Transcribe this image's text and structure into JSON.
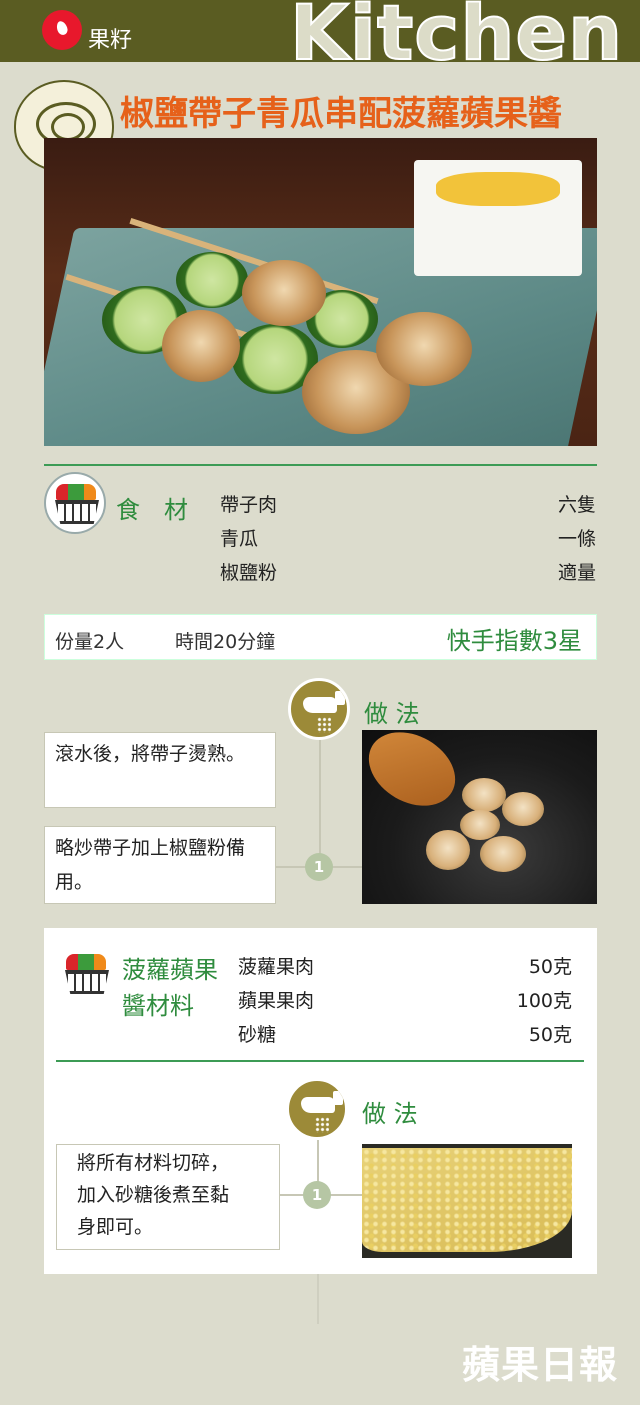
{
  "header": {
    "brand": "果籽",
    "section": "Kitchen"
  },
  "recipe": {
    "title": "椒鹽帶子青瓜串配菠蘿蘋果醬"
  },
  "ingredients": {
    "label": "食　材",
    "items": [
      {
        "name": "帶子肉",
        "amount": "六隻"
      },
      {
        "name": "青瓜",
        "amount": "一條"
      },
      {
        "name": "椒鹽粉",
        "amount": "適量"
      }
    ]
  },
  "info": {
    "servings": "份量2人",
    "time": "時間20分鐘",
    "quick_index": "快手指數3星"
  },
  "method1": {
    "label": "做 法",
    "steps": [
      "滾水後，將帶子燙熟。",
      "略炒帶子加上椒鹽粉備用。"
    ],
    "step_number": "1"
  },
  "sauce": {
    "label_line1": "菠蘿蘋果",
    "label_line2": "醬材料",
    "items": [
      {
        "name": "菠蘿果肉",
        "amount": "50克"
      },
      {
        "name": "蘋果果肉",
        "amount": "100克"
      },
      {
        "name": "砂糖",
        "amount": "50克"
      }
    ]
  },
  "method2": {
    "label": "做 法",
    "step_line1": "將所有材料切碎，",
    "step_line2": "加入砂糖後煮至黏",
    "step_line3": "身即可。",
    "step_number": "1"
  },
  "footer": {
    "masthead": "蘋果日報"
  },
  "colors": {
    "header_band": "#5a5c22",
    "title": "#e6611a",
    "accent_green": "#2f8c3e",
    "background": "#dcdccd"
  }
}
